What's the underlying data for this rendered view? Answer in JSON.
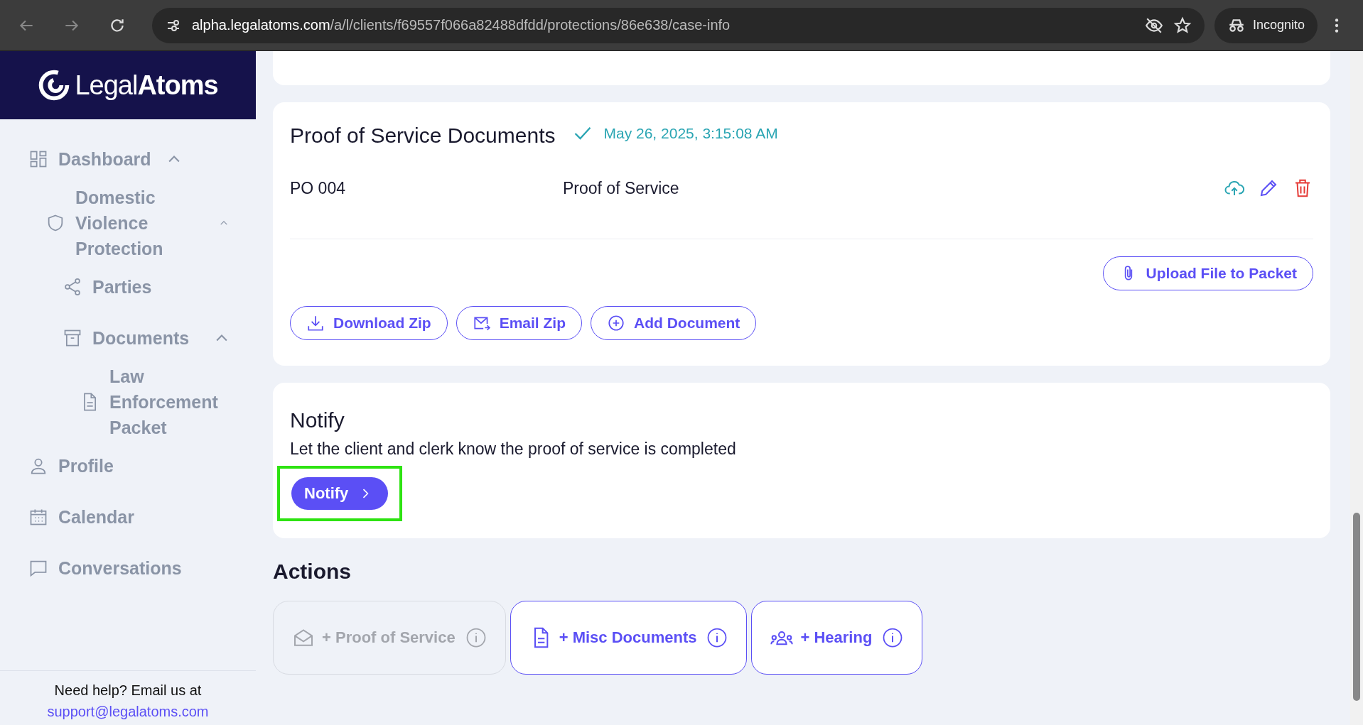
{
  "browser": {
    "url_host": "alpha.legalatoms.com",
    "url_path": "/a/l/clients/f69557f066a82488dfdd/protections/86e638/case-info",
    "profile": "Incognito"
  },
  "sidebar": {
    "logo_light": "Legal",
    "logo_bold": "Atoms",
    "items": [
      {
        "label": "Dashboard",
        "expanded": true,
        "children": [
          {
            "label": "Domestic Violence Protection",
            "expanded": true,
            "children": [
              {
                "label": "Parties"
              },
              {
                "label": "Documents",
                "expanded": true,
                "children": [
                  {
                    "label": "Law Enforcement Packet"
                  }
                ]
              }
            ]
          }
        ]
      },
      {
        "label": "Profile"
      },
      {
        "label": "Calendar"
      },
      {
        "label": "Conversations"
      }
    ],
    "help_text": "Need help? Email us at",
    "help_email": "support@legalatoms.com"
  },
  "proof_card": {
    "title": "Proof of Service Documents",
    "completed": true,
    "timestamp": "May 26, 2025, 3:15:08 AM",
    "documents": [
      {
        "code": "PO 004",
        "name": "Proof of Service"
      }
    ],
    "upload_button": "Upload File to Packet",
    "buttons": [
      {
        "kind": "download",
        "label": "Download Zip"
      },
      {
        "kind": "email",
        "label": "Email Zip"
      },
      {
        "kind": "add",
        "label": "Add Document"
      }
    ]
  },
  "notify_card": {
    "title": "Notify",
    "description": "Let the client and clerk know the proof of service is completed",
    "button": "Notify",
    "highlighted": true
  },
  "actions": {
    "title": "Actions",
    "items": [
      {
        "kind": "mail",
        "label": "+ Proof of Service",
        "disabled": true
      },
      {
        "kind": "document",
        "label": "+ Misc Documents",
        "disabled": false
      },
      {
        "kind": "people",
        "label": "+ Hearing",
        "disabled": false
      }
    ]
  }
}
